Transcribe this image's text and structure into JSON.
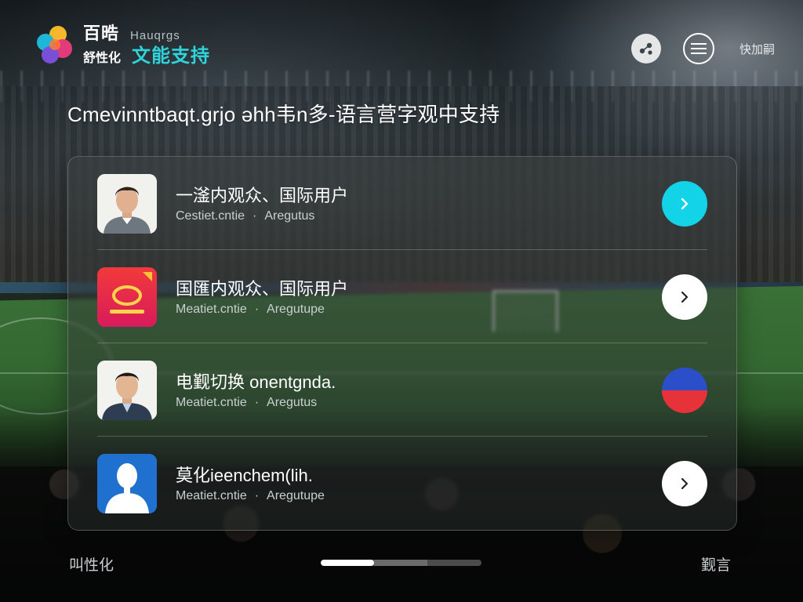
{
  "brand": {
    "line1_cn": "百晧",
    "line1_en": "Hauqrgs",
    "line2_cn": "舒性化",
    "tagline": "文能支持"
  },
  "header": {
    "share_icon": "share-icon",
    "menu_icon": "menu-icon",
    "link_label": "快加嗣"
  },
  "headline": "Cmevinntbaqt.grjo əhh韦n多-语言营字观中支持",
  "rows": [
    {
      "title": "一滏内观众、国际用户",
      "sub_left": "Cestiet.cntie",
      "sub_right": "Aregutus",
      "avatar": "man-portrait",
      "action": "cyan-chevron-button"
    },
    {
      "title": "国匯内观众、国际用户",
      "sub_left": "Meatiet.cntie",
      "sub_right": "Aregutupe",
      "avatar": "red-app-icon",
      "action": "white-chevron-button"
    },
    {
      "title": "电觐切换 onentgnda.",
      "sub_left": "Meatiet.cntie",
      "sub_right": "Aregutus",
      "avatar": "man-portrait-2",
      "action": "flag-button"
    },
    {
      "title": "莫化ieenchem(lih.",
      "sub_left": "Meatiet.cntie",
      "sub_right": "Aregutupe",
      "avatar": "blue-user-silhouette",
      "action": "white-chevron-button"
    }
  ],
  "footer": {
    "left": "叫性化",
    "right": "觐言",
    "progress": 0.33
  },
  "colors": {
    "accent_cyan": "#12d3e8",
    "tagline_cyan": "#2fd3d9",
    "flag_blue": "#2a4fc8",
    "flag_red": "#e8323a",
    "app_red": "#e8263e"
  }
}
